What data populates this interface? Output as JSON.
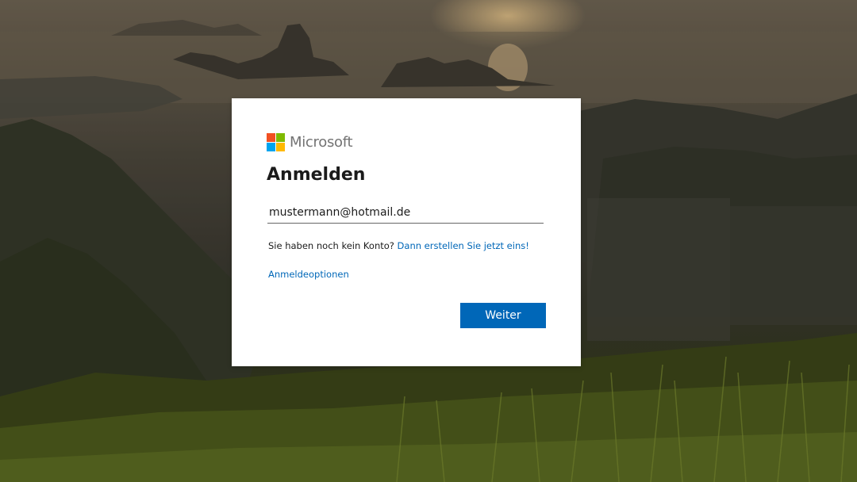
{
  "colors": {
    "accent": "#0067b8",
    "logo_red": "#f25022",
    "logo_green": "#7fba00",
    "logo_blue": "#00a4ef",
    "logo_yellow": "#ffb900",
    "brand_text": "#737373"
  },
  "background": {
    "description_icon": "sunset-landscape-image"
  },
  "card": {
    "brand": "Microsoft",
    "title": "Anmelden",
    "email_value": "mustermann@hotmail.de",
    "no_account_text": "Sie haben noch kein Konto?",
    "create_account_link": "Dann erstellen Sie jetzt eins!",
    "signin_options_link": "Anmeldeoptionen",
    "next_button": "Weiter"
  }
}
